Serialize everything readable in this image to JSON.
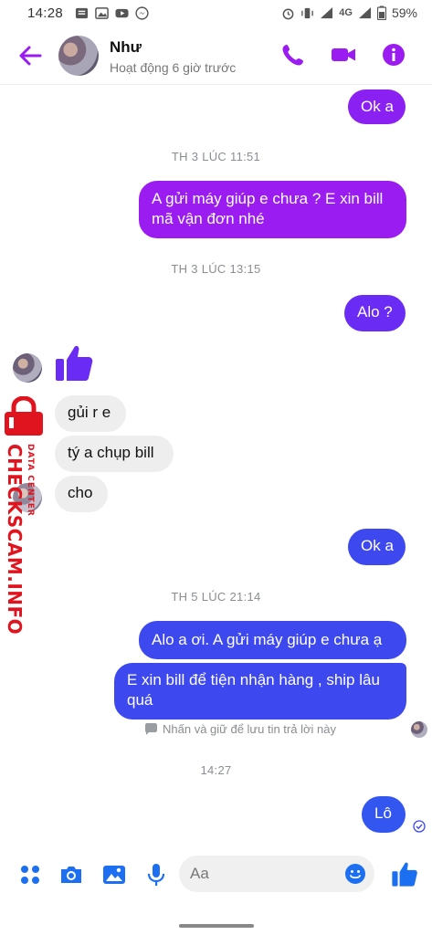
{
  "status_bar": {
    "time": "14:28",
    "battery": "59%",
    "network": "4G"
  },
  "header": {
    "contact_name": "Như",
    "contact_status": "Hoạt động 6 giờ trước",
    "icons": [
      "back-arrow-icon",
      "phone-icon",
      "video-camera-icon",
      "info-icon"
    ],
    "accent_color": "#9b1cf0"
  },
  "messages": [
    {
      "type": "out",
      "text": "Ok a"
    },
    {
      "type": "timestamp",
      "text": "TH 3 LÚC 11:51"
    },
    {
      "type": "out",
      "lines": [
        "A gửi máy giúp e chưa ? E xin bill",
        "mã vận đơn nhé"
      ]
    },
    {
      "type": "timestamp",
      "text": "TH 3 LÚC 13:15"
    },
    {
      "type": "out",
      "text": "Alo ?"
    },
    {
      "type": "in_like",
      "icon": "thumbs-up-icon"
    },
    {
      "type": "in",
      "text": "gủi r e"
    },
    {
      "type": "in",
      "text": "tý a chụp bill"
    },
    {
      "type": "in",
      "text": "cho"
    },
    {
      "type": "out",
      "text": "Ok a"
    },
    {
      "type": "timestamp",
      "text": "TH 5 LÚC 21:14"
    },
    {
      "type": "out",
      "text": "Alo a ơi. A gửi máy giúp e chưa ạ"
    },
    {
      "type": "out",
      "lines": [
        "E xin bill để tiện nhận hàng , ship lâu",
        "quá"
      ]
    },
    {
      "type": "hint",
      "text": "Nhấn và giữ để lưu tin trả lời này"
    },
    {
      "type": "timestamp",
      "text": "14:27"
    },
    {
      "type": "out",
      "text": "Lô",
      "status": "sent-check-icon"
    }
  ],
  "watermark": {
    "main": "CHECKSCAM.INFO",
    "sub": "DATA CENTER"
  },
  "composer": {
    "placeholder": "Aa",
    "icons": [
      "menu-dots-icon",
      "camera-icon",
      "image-icon",
      "microphone-icon",
      "emoji-icon",
      "thumbs-up-icon"
    ]
  }
}
